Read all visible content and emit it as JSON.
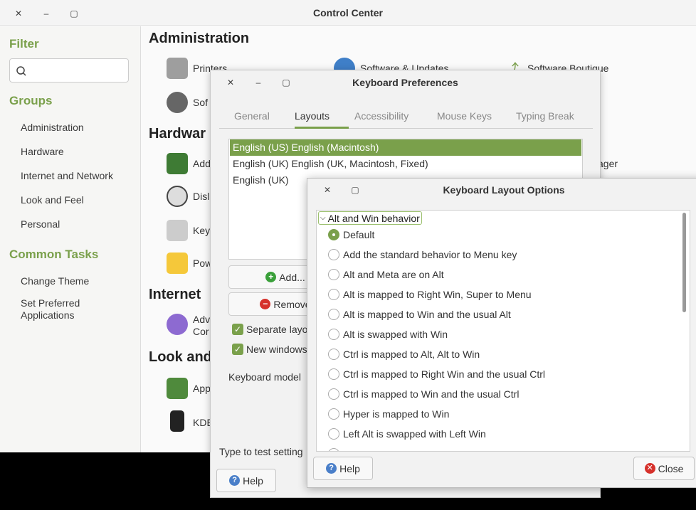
{
  "control_center": {
    "title": "Control Center",
    "filter_heading": "Filter",
    "groups_heading": "Groups",
    "groups": [
      "Administration",
      "Hardware",
      "Internet and Network",
      "Look and Feel",
      "Personal"
    ],
    "tasks_heading": "Common Tasks",
    "tasks": [
      "Change Theme",
      "Set Preferred\nApplications"
    ],
    "sections": [
      "Administration",
      "Hardwar",
      "Internet",
      "Look and"
    ],
    "items": {
      "printers": "Printers",
      "software_updates": "Software & Updates",
      "software_boutique": "Software Boutique",
      "sof": "Sof",
      "add": "Add",
      "manager": "ager",
      "dis": "Disl",
      "key": "Key",
      "pow": "Pow",
      "adv": "Adv",
      "con": "Cor",
      "app": "App",
      "kde": "KDE"
    }
  },
  "keyboard_preferences": {
    "title": "Keyboard Preferences",
    "tabs": [
      "General",
      "Layouts",
      "Accessibility",
      "Mouse Keys",
      "Typing Break"
    ],
    "active_tab": "Layouts",
    "layouts": [
      "English (US) English (Macintosh)",
      "English (UK) English (UK, Macintosh, Fixed)",
      "English (UK)"
    ],
    "add_button": "Add...",
    "remove_button": "Remove",
    "separate_layout_label": "Separate layo",
    "new_windows_label": "New windows",
    "keyboard_model_label": "Keyboard model",
    "type_to_test_label": "Type to test setting",
    "help_button": "Help"
  },
  "layout_options": {
    "title": "Keyboard Layout Options",
    "group_label": "Alt and Win behavior",
    "options": [
      "Default",
      "Add the standard behavior to Menu key",
      "Alt and Meta are on Alt",
      "Alt is mapped to Right Win, Super to Menu",
      "Alt is mapped to Win and the usual Alt",
      "Alt is swapped with Win",
      "Ctrl is mapped to Alt, Alt to Win",
      "Ctrl is mapped to Right Win and the usual Ctrl",
      "Ctrl is mapped to Win and the usual Ctrl",
      "Hyper is mapped to Win",
      "Left Alt is swapped with Left Win"
    ],
    "selected_option": "Default",
    "help_button": "Help",
    "close_button": "Close"
  },
  "colors": {
    "accent": "#7aa04b"
  }
}
